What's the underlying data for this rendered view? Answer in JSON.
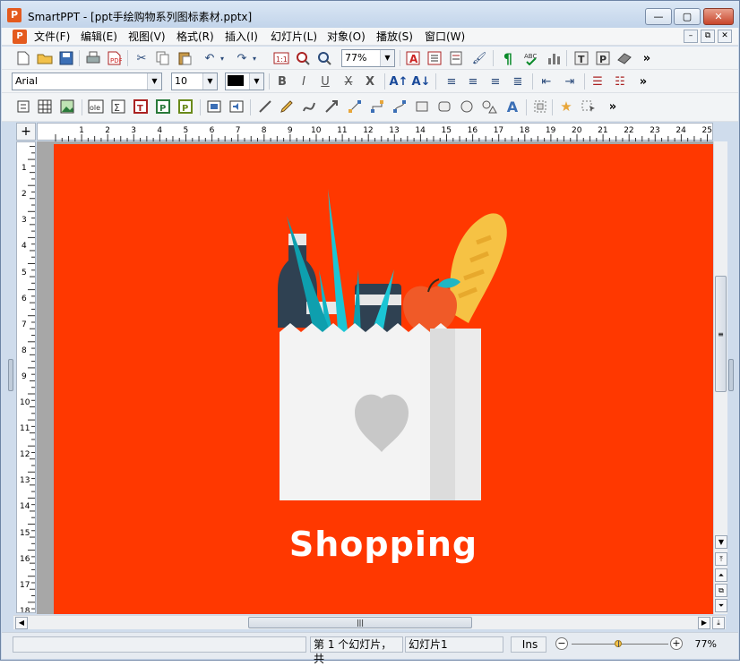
{
  "window": {
    "title": "SmartPPT - [ppt手绘购物系列图标素材.pptx]",
    "app_icon": "P",
    "buttons": {
      "minimize": "—",
      "restore": "▢",
      "close": "✕"
    }
  },
  "menu": {
    "items": [
      "文件(F)",
      "编辑(E)",
      "视图(V)",
      "格式(R)",
      "插入(I)",
      "幻灯片(L)",
      "对象(O)",
      "播放(S)",
      "窗口(W)"
    ],
    "mdi": {
      "minimize": "–",
      "restore": "⧉",
      "close": "✕"
    }
  },
  "toolbar": {
    "zoom_value": "77%",
    "font_name": "Arial",
    "font_size": "10",
    "overflow": "»"
  },
  "ruler": {
    "h_numbers": [
      "1",
      "2",
      "3",
      "4",
      "5",
      "6",
      "7",
      "8",
      "9",
      "10",
      "11",
      "12",
      "13",
      "14",
      "15",
      "16",
      "17",
      "18",
      "19",
      "20",
      "21",
      "22",
      "23",
      "24",
      "25"
    ],
    "v_numbers": [
      "1",
      "2",
      "3",
      "4",
      "5",
      "6",
      "7",
      "8",
      "9",
      "10",
      "11",
      "12",
      "13",
      "14",
      "15",
      "16",
      "17",
      "18"
    ],
    "corner": "+"
  },
  "slide": {
    "title": "Shopping",
    "bg_color": "#ff3800"
  },
  "scroll": {
    "thumb_grip": "≡",
    "hthumb_grip": "|||"
  },
  "status": {
    "slide_info": "第 1 个幻灯片，共",
    "slide_name": "幻灯片1",
    "mode": "Ins",
    "zoom": "77%",
    "zoom_level": 0.48
  }
}
